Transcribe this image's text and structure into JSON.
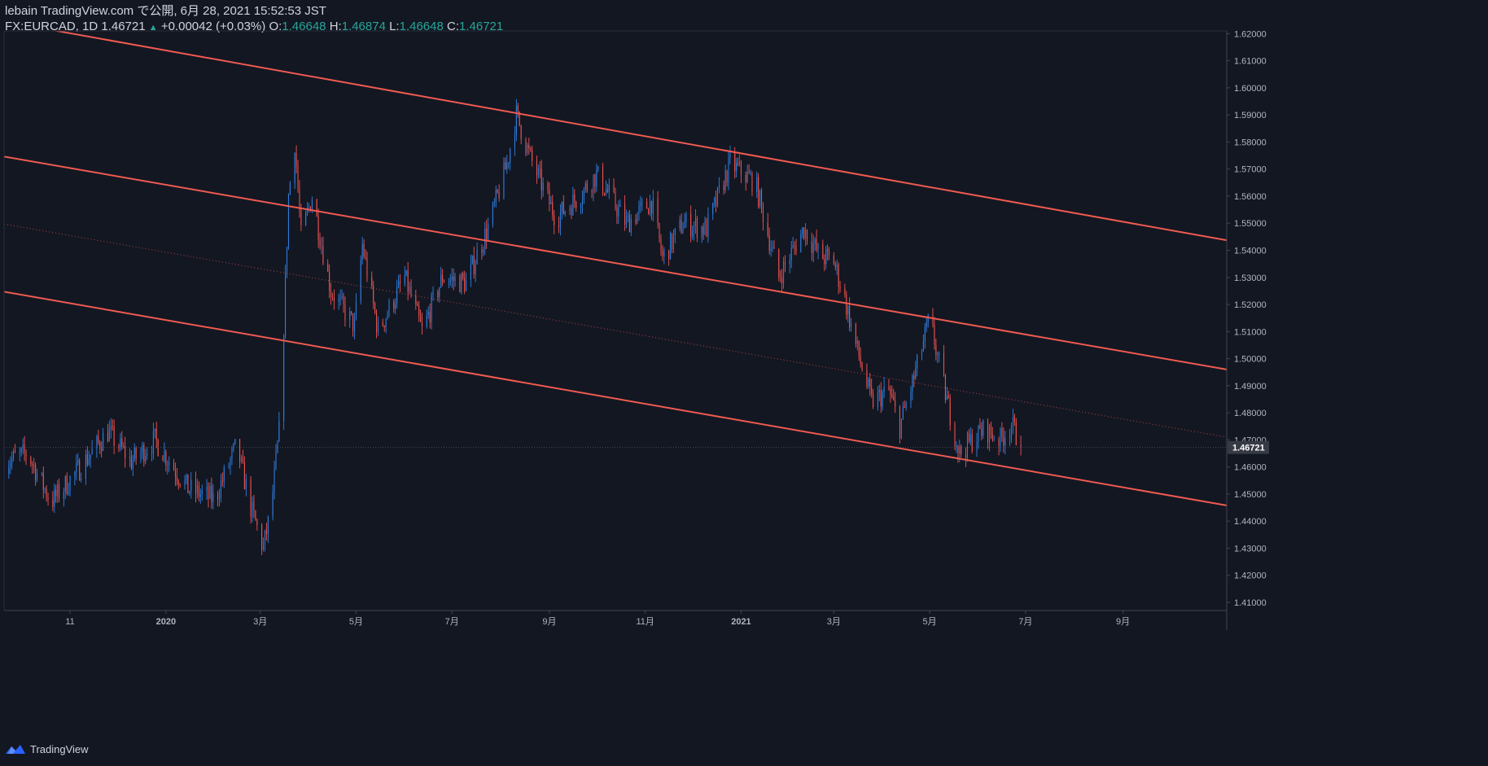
{
  "header": {
    "publish_line": "lebain TradingView.com で公開, 6月 28, 2021 15:52:53 JST",
    "symbol": "FX:EURCAD, 1D",
    "last": "1.46721",
    "change": "+0.00042 (+0.03%)",
    "o_label": "O:",
    "o_value": "1.46648",
    "h_label": "H:",
    "h_value": "1.46874",
    "l_label": "L:",
    "l_value": "1.46648",
    "c_label": "C:",
    "c_value": "1.46721"
  },
  "footer": {
    "brand": "TradingView",
    "logo_icon": "tradingview-logo-icon"
  },
  "colors": {
    "background": "#131722",
    "up": "#2f7fe0",
    "down": "#ef5350",
    "channel": "#f05a50",
    "axis_text": "#b2b5be",
    "grid_line": "#363a45"
  },
  "chart_data": {
    "type": "candlestick",
    "symbol": "FX:EURCAD",
    "interval": "1D",
    "last_price": "1.46721",
    "y_axis": {
      "range": [
        1.407,
        1.621
      ],
      "ticks": [
        "1.62000",
        "1.61000",
        "1.60000",
        "1.59000",
        "1.58000",
        "1.57000",
        "1.56000",
        "1.55000",
        "1.54000",
        "1.53000",
        "1.52000",
        "1.51000",
        "1.50000",
        "1.49000",
        "1.48000",
        "1.47000",
        "1.46000",
        "1.45000",
        "1.44000",
        "1.43000",
        "1.42000",
        "1.41000"
      ]
    },
    "x_axis": {
      "ticks": [
        "11",
        "2020",
        "3月",
        "5月",
        "7月",
        "9月",
        "11月",
        "2021",
        "3月",
        "5月",
        "7月",
        "9月"
      ],
      "tick_dates": [
        "2019-11-01",
        "2020-01-01",
        "2020-03-01",
        "2020-05-01",
        "2020-07-01",
        "2020-09-01",
        "2020-11-01",
        "2021-01-01",
        "2021-03-01",
        "2021-05-01",
        "2021-07-01",
        "2021-09-01"
      ],
      "range": [
        "2019-09-20",
        "2021-11-06"
      ]
    },
    "path_anchors": [
      {
        "date": "2019-09-20",
        "close": 1.462
      },
      {
        "date": "2019-10-05",
        "close": 1.465
      },
      {
        "date": "2019-10-20",
        "close": 1.447
      },
      {
        "date": "2019-11-05",
        "close": 1.458
      },
      {
        "date": "2019-11-25",
        "close": 1.473
      },
      {
        "date": "2019-12-10",
        "close": 1.462
      },
      {
        "date": "2019-12-25",
        "close": 1.47
      },
      {
        "date": "2020-01-15",
        "close": 1.452
      },
      {
        "date": "2020-02-01",
        "close": 1.448
      },
      {
        "date": "2020-02-15",
        "close": 1.468
      },
      {
        "date": "2020-02-24",
        "close": 1.445
      },
      {
        "date": "2020-03-03",
        "close": 1.43
      },
      {
        "date": "2020-03-08",
        "close": 1.445
      },
      {
        "date": "2020-03-13",
        "close": 1.473
      },
      {
        "date": "2020-03-16",
        "close": 1.512
      },
      {
        "date": "2020-03-19",
        "close": 1.56
      },
      {
        "date": "2020-03-23",
        "close": 1.58
      },
      {
        "date": "2020-03-27",
        "close": 1.545
      },
      {
        "date": "2020-04-03",
        "close": 1.56
      },
      {
        "date": "2020-04-15",
        "close": 1.525
      },
      {
        "date": "2020-04-30",
        "close": 1.512
      },
      {
        "date": "2020-05-05",
        "close": 1.542
      },
      {
        "date": "2020-05-15",
        "close": 1.51
      },
      {
        "date": "2020-06-01",
        "close": 1.53
      },
      {
        "date": "2020-06-12",
        "close": 1.51
      },
      {
        "date": "2020-06-25",
        "close": 1.53
      },
      {
        "date": "2020-07-10",
        "close": 1.528
      },
      {
        "date": "2020-07-25",
        "close": 1.55
      },
      {
        "date": "2020-08-05",
        "close": 1.572
      },
      {
        "date": "2020-08-11",
        "close": 1.59
      },
      {
        "date": "2020-08-20",
        "close": 1.574
      },
      {
        "date": "2020-09-05",
        "close": 1.552
      },
      {
        "date": "2020-09-20",
        "close": 1.56
      },
      {
        "date": "2020-10-01",
        "close": 1.568
      },
      {
        "date": "2020-10-20",
        "close": 1.55
      },
      {
        "date": "2020-11-05",
        "close": 1.558
      },
      {
        "date": "2020-11-12",
        "close": 1.537
      },
      {
        "date": "2020-11-25",
        "close": 1.55
      },
      {
        "date": "2020-12-10",
        "close": 1.548
      },
      {
        "date": "2020-12-25",
        "close": 1.572
      },
      {
        "date": "2021-01-10",
        "close": 1.565
      },
      {
        "date": "2021-01-25",
        "close": 1.53
      },
      {
        "date": "2021-02-10",
        "close": 1.548
      },
      {
        "date": "2021-02-20",
        "close": 1.538
      },
      {
        "date": "2021-03-01",
        "close": 1.536
      },
      {
        "date": "2021-03-08",
        "close": 1.522
      },
      {
        "date": "2021-03-15",
        "close": 1.505
      },
      {
        "date": "2021-03-25",
        "close": 1.484
      },
      {
        "date": "2021-04-05",
        "close": 1.488
      },
      {
        "date": "2021-04-12",
        "close": 1.475
      },
      {
        "date": "2021-04-22",
        "close": 1.495
      },
      {
        "date": "2021-05-01",
        "close": 1.515
      },
      {
        "date": "2021-05-08",
        "close": 1.495
      },
      {
        "date": "2021-05-15",
        "close": 1.477
      },
      {
        "date": "2021-05-20",
        "close": 1.465
      },
      {
        "date": "2021-05-28",
        "close": 1.47
      },
      {
        "date": "2021-06-05",
        "close": 1.474
      },
      {
        "date": "2021-06-15",
        "close": 1.47
      },
      {
        "date": "2021-06-22",
        "close": 1.476
      },
      {
        "date": "2021-06-28",
        "close": 1.4672
      }
    ],
    "channel_lines": [
      {
        "name": "upper",
        "style": "solid",
        "from": {
          "date": "2019-09-20",
          "price": 1.6245
        },
        "to": {
          "date": "2021-11-06",
          "price": 1.5437
        }
      },
      {
        "name": "middle",
        "style": "solid",
        "from": {
          "date": "2019-09-20",
          "price": 1.5746
        },
        "to": {
          "date": "2021-11-06",
          "price": 1.496
        }
      },
      {
        "name": "lower",
        "style": "solid",
        "from": {
          "date": "2019-09-20",
          "price": 1.5247
        },
        "to": {
          "date": "2021-11-06",
          "price": 1.4458
        }
      },
      {
        "name": "mid-dotted",
        "style": "dotted",
        "from": {
          "date": "2019-09-20",
          "price": 1.5497
        },
        "to": {
          "date": "2021-11-06",
          "price": 1.471
        }
      }
    ],
    "grid": false,
    "legend": "none"
  }
}
